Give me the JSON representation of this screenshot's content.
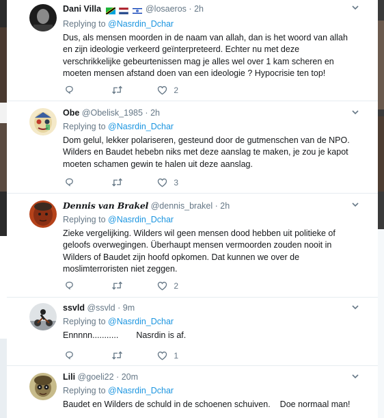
{
  "colors": {
    "link": "#1b95e0",
    "muted": "#657786",
    "text": "#14171a",
    "divider": "#e6ecf0"
  },
  "tweets": [
    {
      "name": "Dani Villa",
      "flags": [
        "tanzania-flag",
        "netherlands-flag",
        "israel-flag"
      ],
      "handle": "@losaeros",
      "dot": "·",
      "time": "2h",
      "replying_prefix": "Replying to",
      "replying_to": "@Nasrdin_Dchar",
      "text": "Dus, als mensen moorden in de naam van allah, dan is het woord van allah en zijn ideologie verkeerd geïnterpreteerd. Echter nu met deze verschrikkelijke gebeurtenissen mag je alles wel over 1 kam scheren en moeten mensen afstand doen van een ideologie ? Hypocrisie ten top!",
      "reply_count": "",
      "retweet_count": "",
      "like_count": "2"
    },
    {
      "name": "Obe",
      "flags": [],
      "handle": "@Obelisk_1985",
      "dot": "·",
      "time": "2h",
      "replying_prefix": "Replying to",
      "replying_to": "@Nasrdin_Dchar",
      "text": "Dom gelul, lekker polariseren, gesteund door de gutmenschen van de NPO. Wilders en Baudet hebebn niks met deze aanslag te maken, je zou je kapot moeten schamen gewin te halen uit deze aanslag.",
      "reply_count": "",
      "retweet_count": "",
      "like_count": "3"
    },
    {
      "name": "Dennis van Brakel",
      "flags": [],
      "handle": "@dennis_brakel",
      "dot": "·",
      "time": "2h",
      "replying_prefix": "Replying to",
      "replying_to": "@Nasrdin_Dchar",
      "text": "Zieke vergelijking. Wilders wil geen mensen dood hebben uit politieke of geloofs overwegingen. Überhaupt mensen vermoorden zouden nooit in Wilders of Baudet zijn hoofd opkomen. Dat kunnen we over de moslimterroristen niet zeggen.",
      "reply_count": "",
      "retweet_count": "",
      "like_count": "2"
    },
    {
      "name": "ssvld",
      "flags": [],
      "handle": "@ssvld",
      "dot": "·",
      "time": "9m",
      "replying_prefix": "Replying to",
      "replying_to": "@Nasrdin_Dchar",
      "text_a": "Ennnnn...........",
      "text_b": "Nasrdin is af.",
      "reply_count": "",
      "retweet_count": "",
      "like_count": "1"
    },
    {
      "name": "Lili",
      "flags": [],
      "handle": "@goeli22",
      "dot": "·",
      "time": "20m",
      "replying_prefix": "Replying to",
      "replying_to": "@Nasrdin_Dchar",
      "text_a": "Baudet en Wilders de schuld in de schoenen schuiven.",
      "text_b": "Doe normaal man!"
    }
  ]
}
